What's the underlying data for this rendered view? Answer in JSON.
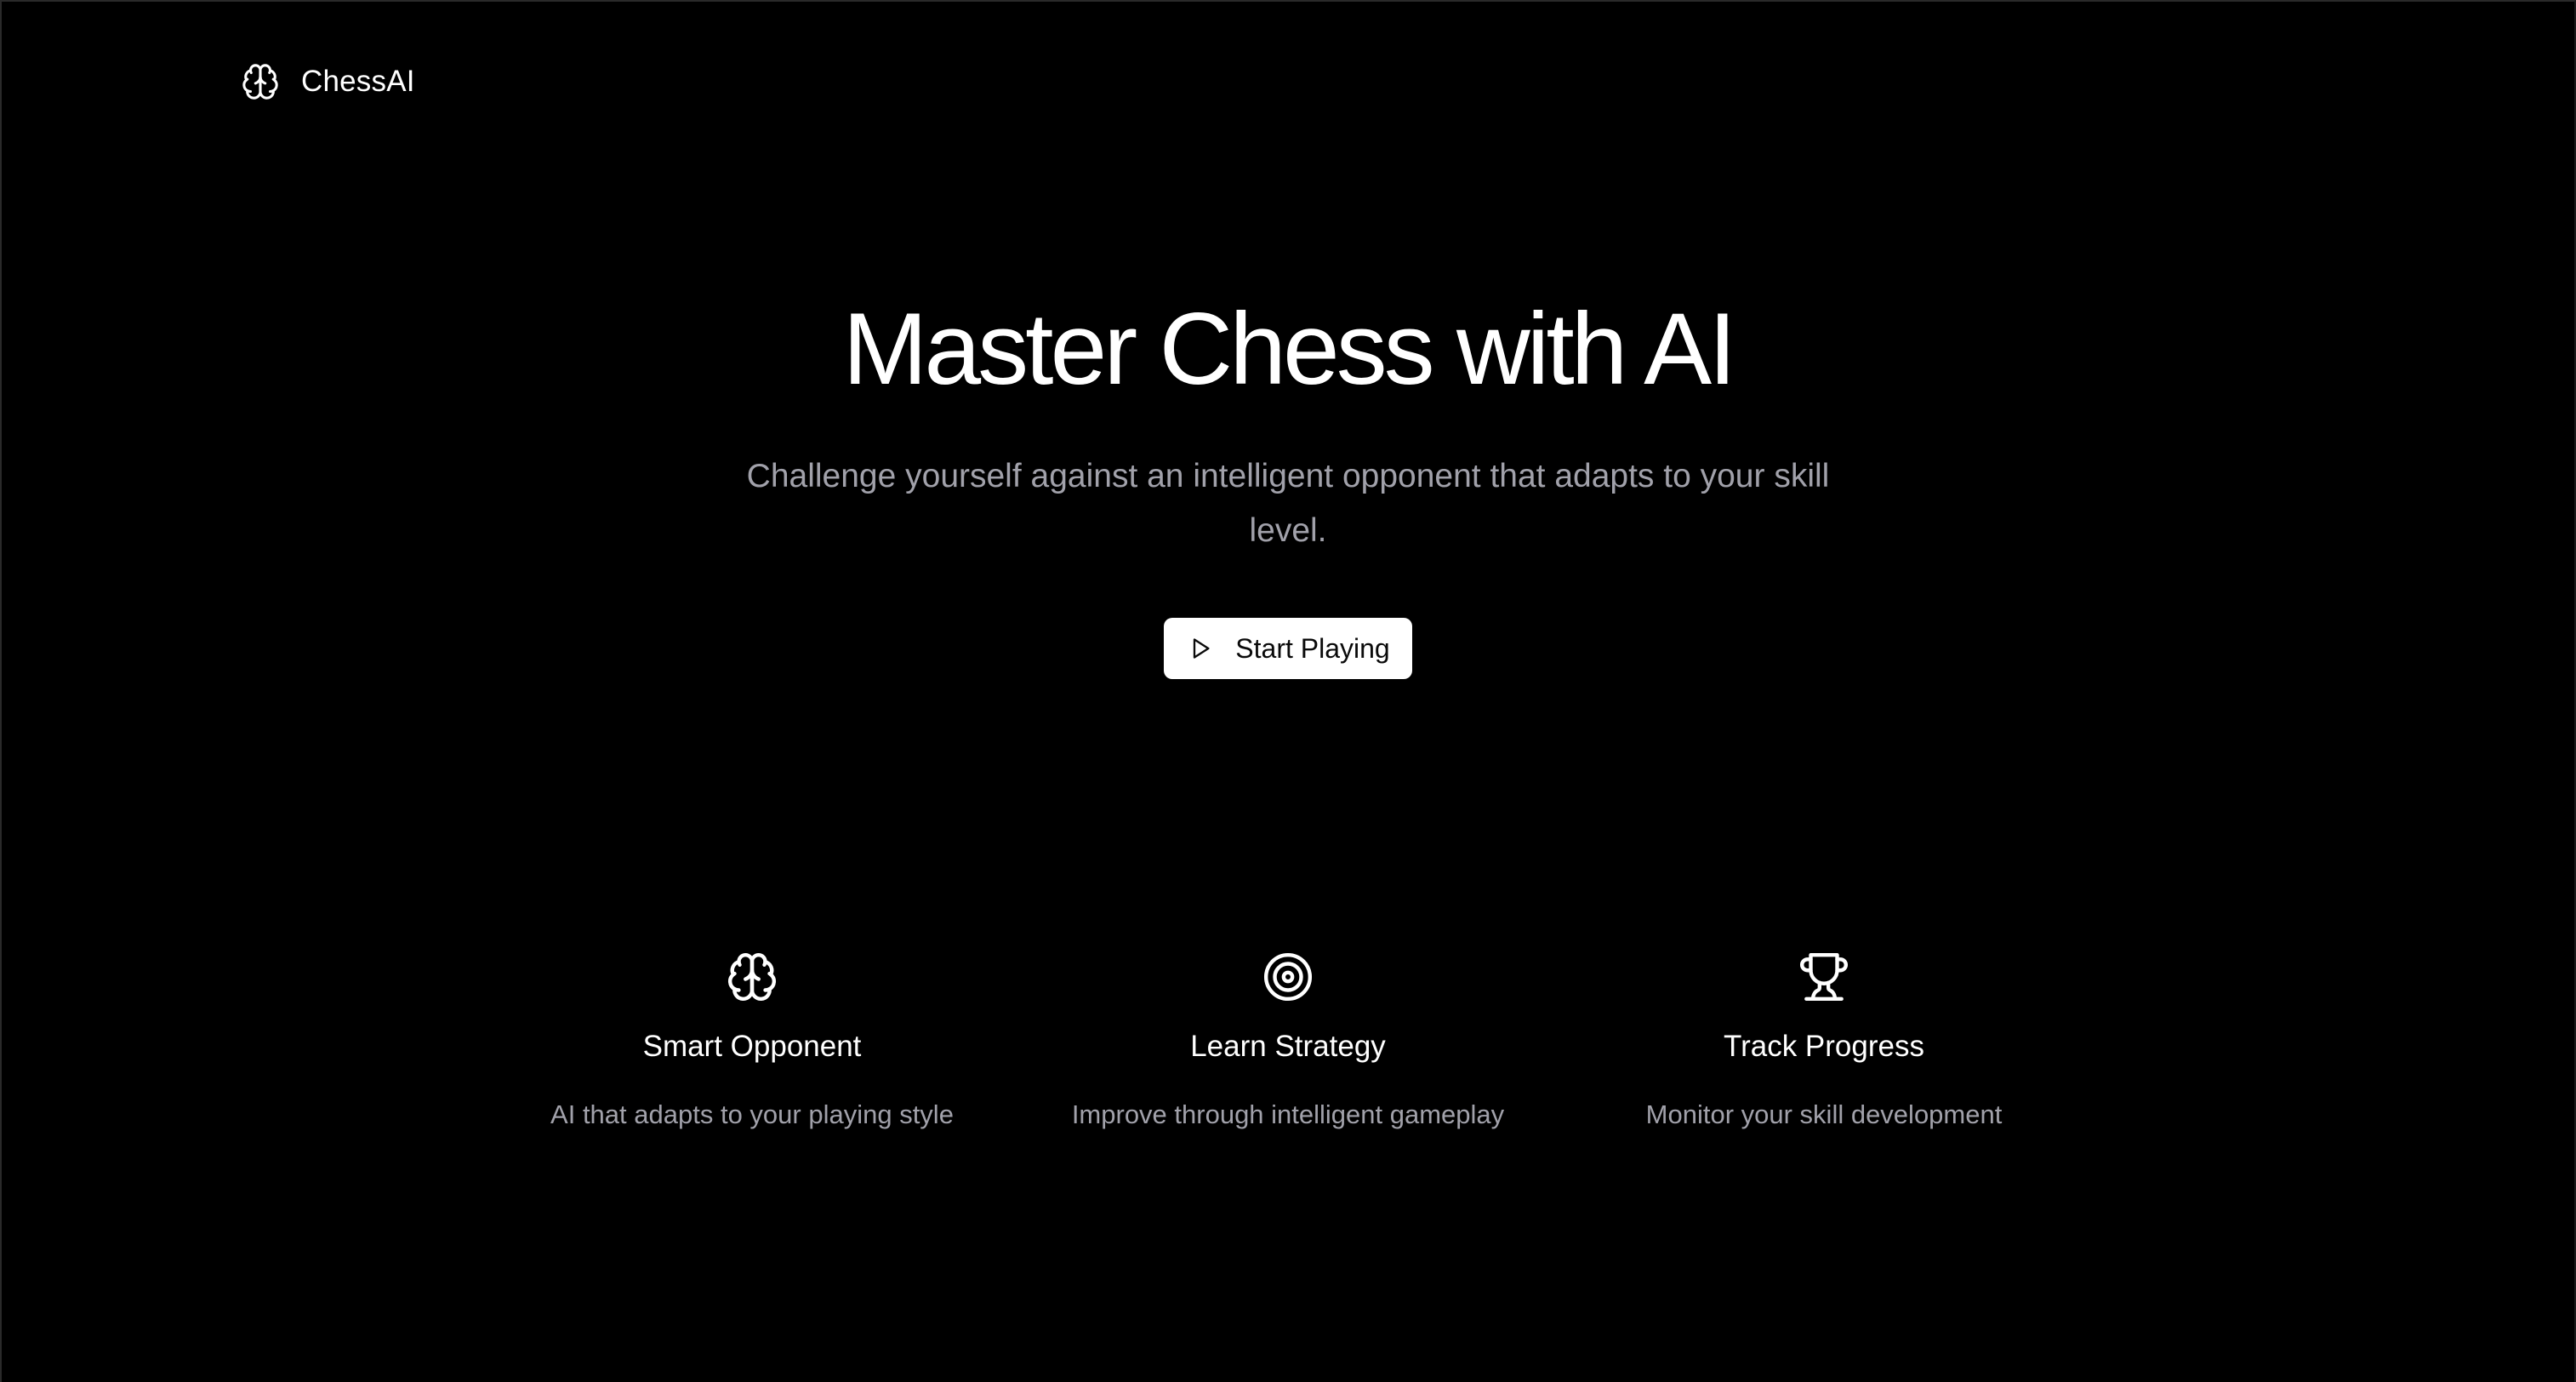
{
  "header": {
    "logo_icon": "brain-icon",
    "brand": "ChessAI"
  },
  "hero": {
    "title": "Master Chess with AI",
    "subtitle": "Challenge yourself against an intelligent opponent that adapts to your skill level.",
    "cta": {
      "label": "Start Playing",
      "icon": "play-icon"
    }
  },
  "features": [
    {
      "icon": "brain-icon",
      "title": "Smart Opponent",
      "description": "AI that adapts to your playing style"
    },
    {
      "icon": "target-icon",
      "title": "Learn Strategy",
      "description": "Improve through intelligent gameplay"
    },
    {
      "icon": "trophy-icon",
      "title": "Track Progress",
      "description": "Monitor your skill development"
    }
  ],
  "colors": {
    "background": "#000000",
    "text": "#ffffff",
    "muted": "#a1a1aa",
    "button_bg": "#ffffff",
    "button_text": "#0a0a0a"
  }
}
